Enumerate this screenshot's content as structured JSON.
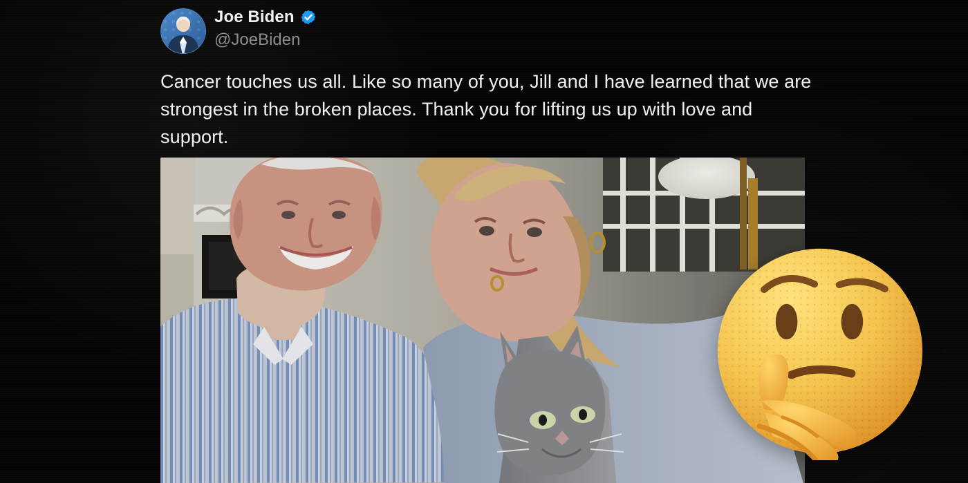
{
  "tweet": {
    "author": {
      "display_name": "Joe Biden",
      "handle": "@JoeBiden",
      "verified_icon": "verified-badge-icon"
    },
    "text": "Cancer touches us all. Like so many of you, Jill and I have learned that we are strongest in the broken places. Thank you for lifting us up with love and support.",
    "media": {
      "kind": "photo"
    }
  },
  "overlay": {
    "emoji": "thinking-face-icon"
  },
  "colors": {
    "background": "#050505",
    "text": "#f1f1f1",
    "handle": "#8d8d8d",
    "verified": "#1d9bf0",
    "emoji_face": "#f4c44d"
  }
}
